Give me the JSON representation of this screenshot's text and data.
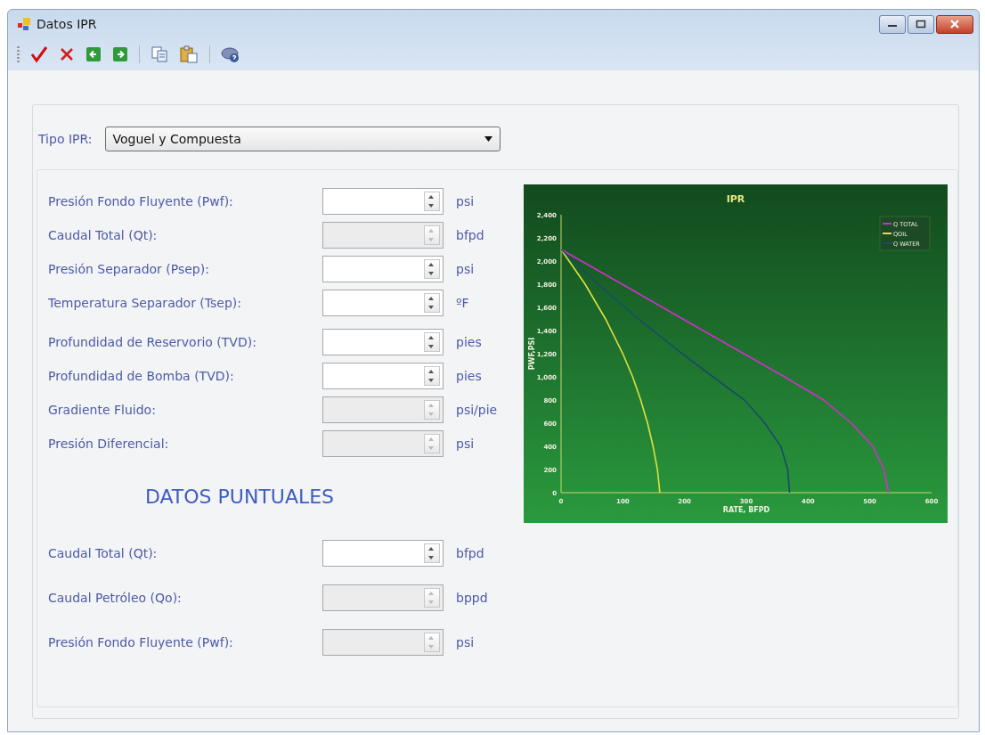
{
  "window": {
    "title": "Datos IPR"
  },
  "toolbar": [
    {
      "kind": "accept"
    },
    {
      "kind": "cancel"
    },
    {
      "kind": "back"
    },
    {
      "kind": "forward"
    },
    {
      "kind": "separator"
    },
    {
      "kind": "copy"
    },
    {
      "kind": "paste"
    },
    {
      "kind": "separator"
    },
    {
      "kind": "help"
    }
  ],
  "ipr_type": {
    "label": "Tipo IPR:",
    "value": "Voguel y Compuesta"
  },
  "fields": [
    {
      "label": "Presión Fondo Fluyente (Pwf):",
      "unit": "psi",
      "disabled": false
    },
    {
      "label": "Caudal Total (Qt):",
      "unit": "bfpd",
      "disabled": true
    },
    {
      "label": "Presión Separador (Psep):",
      "unit": "psi",
      "disabled": false
    },
    {
      "label": "Temperatura Separador (Tsep):",
      "unit": "ºF",
      "disabled": false
    },
    {
      "label": "Profundidad de Reservorio (TVD):",
      "unit": "pies",
      "disabled": false
    },
    {
      "label": "Profundidad de Bomba (TVD):",
      "unit": "pies",
      "disabled": false
    },
    {
      "label": "Gradiente Fluido:",
      "unit": "psi/pie",
      "disabled": true
    },
    {
      "label": "Presión Diferencial:",
      "unit": "psi",
      "disabled": true
    }
  ],
  "point_data": {
    "title": "DATOS PUNTUALES",
    "fields": [
      {
        "label": "Caudal Total (Qt):",
        "unit": "bfpd",
        "disabled": false
      },
      {
        "label": "Caudal Petróleo (Qo):",
        "unit": "bppd",
        "disabled": true
      },
      {
        "label": "Presión Fondo Fluyente (Pwf):",
        "unit": "psi",
        "disabled": true
      }
    ]
  },
  "chart": {
    "chart_data": {
      "type": "line",
      "title": "IPR",
      "xlabel": "RATE, BFPD",
      "ylabel": "PWF,PSI",
      "legend": true,
      "xlim": [
        0,
        600
      ],
      "ylim": [
        0,
        2400
      ],
      "xticks": [
        0,
        100,
        200,
        300,
        400,
        500,
        600
      ],
      "yticks": [
        {
          "value": 0,
          "label": "0"
        },
        {
          "value": 200,
          "label": "200"
        },
        {
          "value": 400,
          "label": "400"
        },
        {
          "value": 600,
          "label": "600"
        },
        {
          "value": 800,
          "label": "800"
        },
        {
          "value": 1000,
          "label": "1,000"
        },
        {
          "value": 1200,
          "label": "1,200"
        },
        {
          "value": 1400,
          "label": "1,400"
        },
        {
          "value": 1600,
          "label": "1,600"
        },
        {
          "value": 1800,
          "label": "1,800"
        },
        {
          "value": 2000,
          "label": "2,000"
        },
        {
          "value": 2200,
          "label": "2,200"
        },
        {
          "value": 2400,
          "label": "2,400"
        }
      ],
      "x": [
        0,
        39,
        60,
        72,
        99,
        100,
        116,
        125,
        129,
        140,
        149,
        156,
        160,
        196,
        197,
        246,
        296,
        297,
        330,
        356,
        362,
        367,
        370,
        425,
        470,
        505,
        523,
        530
      ],
      "series": [
        {
          "name": "Q TOTAL",
          "color": "#d030c8",
          "values": [
            2100,
            null,
            null,
            null,
            1800,
            null,
            null,
            null,
            null,
            null,
            null,
            null,
            null,
            null,
            1500,
            null,
            1200,
            null,
            null,
            null,
            1000,
            null,
            null,
            800,
            600,
            400,
            200,
            0
          ]
        },
        {
          "name": "QOIL",
          "color": "#e0e040",
          "values": [
            2100,
            1800,
            null,
            1500,
            null,
            1200,
            1000,
            null,
            800,
            600,
            400,
            200,
            0,
            null,
            null,
            null,
            null,
            null,
            null,
            null,
            null,
            null,
            null,
            null,
            null,
            null,
            null,
            null
          ]
        },
        {
          "name": "Q WATER",
          "color": "#1a4a6a",
          "values": [
            2100,
            null,
            1800,
            null,
            null,
            null,
            null,
            1500,
            null,
            null,
            null,
            null,
            null,
            1200,
            null,
            1000,
            null,
            800,
            600,
            400,
            null,
            200,
            0,
            null,
            null,
            null,
            null,
            null
          ]
        }
      ]
    }
  }
}
